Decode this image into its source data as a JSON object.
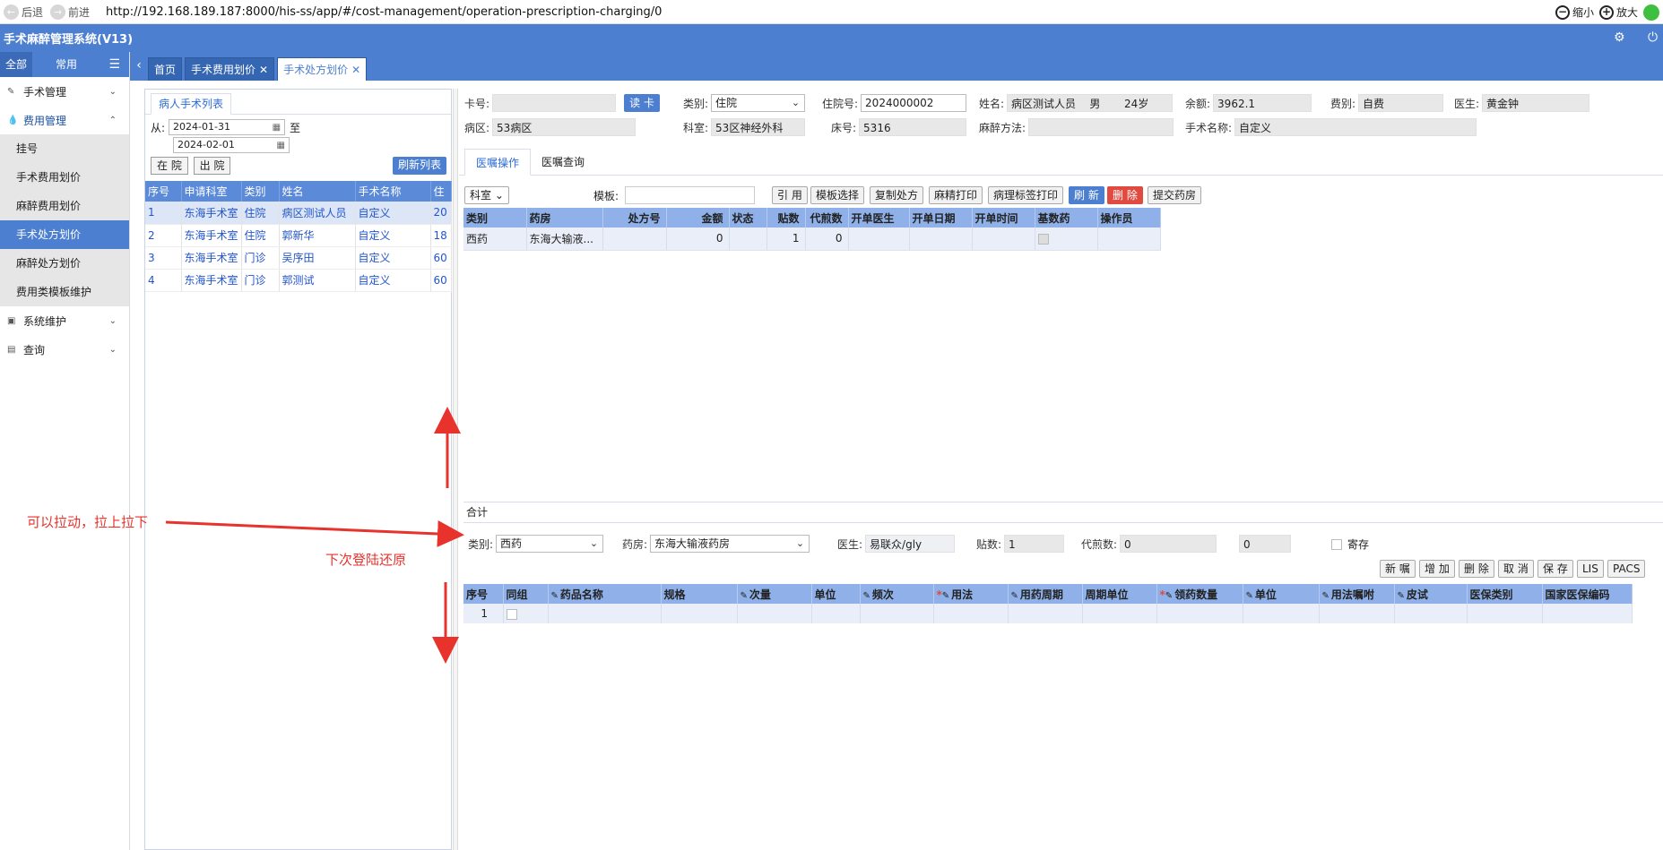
{
  "browser": {
    "back_label": "后退",
    "forward_label": "前进",
    "url": "http://192.168.189.187:8000/his-ss/app/#/cost-management/operation-prescription-charging/0",
    "zoom_out_label": "缩小",
    "zoom_in_label": "放大"
  },
  "app": {
    "title": "手术麻醉管理系统(V13)"
  },
  "sidebar": {
    "tabs": [
      "全部",
      "常用"
    ],
    "groups": [
      {
        "label": "手术管理"
      },
      {
        "label": "费用管理",
        "items": [
          "挂号",
          "手术费用划价",
          "麻醉费用划价",
          "手术处方划价",
          "麻醉处方划价",
          "费用类模板维护"
        ]
      },
      {
        "label": "系统维护"
      },
      {
        "label": "查询"
      }
    ]
  },
  "page_tabs": [
    "首页",
    "手术费用划价",
    "手术处方划价"
  ],
  "patient_panel": {
    "tab_label": "病人手术列表",
    "from_label": "从:",
    "to_label": "至",
    "date_from": "2024-01-31",
    "date_to": "2024-02-01",
    "btn_inpatient": "在 院",
    "btn_discharged": "出 院",
    "btn_refresh": "刷新列表",
    "columns": [
      "序号",
      "申请科室",
      "类别",
      "姓名",
      "手术名称",
      "住"
    ],
    "rows": [
      [
        "1",
        "东海手术室",
        "住院",
        "病区测试人员",
        "自定义",
        "20"
      ],
      [
        "2",
        "东海手术室",
        "住院",
        "郭新华",
        "自定义",
        "18"
      ],
      [
        "3",
        "东海手术室",
        "门诊",
        "吴序田",
        "自定义",
        "60"
      ],
      [
        "4",
        "东海手术室",
        "门诊",
        "郭测试",
        "自定义",
        "60"
      ]
    ]
  },
  "patient_info": {
    "card_label": "卡号:",
    "card_value": "",
    "read_card": "读 卡",
    "type_label": "类别:",
    "type_value": "住院",
    "inpatient_no_label": "住院号:",
    "inpatient_no": "2024000002",
    "name_label": "姓名:",
    "name_value": "病区测试人员",
    "gender": "男",
    "age": "24岁",
    "balance_label": "余额:",
    "balance": "3962.1",
    "fee_type_label": "费别:",
    "fee_type": "自费",
    "doctor_label": "医生:",
    "doctor": "黄金钟",
    "ward_label": "病区:",
    "ward": "53病区",
    "dept_label": "科室:",
    "dept": "53区神经外科",
    "bed_label": "床号:",
    "bed": "5316",
    "anesthesia_label": "麻醉方法:",
    "anesthesia": "",
    "surgery_label": "手术名称:",
    "surgery": "自定义"
  },
  "order_tabs": [
    "医嘱操作",
    "医嘱查询"
  ],
  "toolbar": {
    "dept_select": "科室",
    "template_label": "模板:",
    "template_value": "",
    "buttons": [
      "引 用",
      "模板选择",
      "复制处方",
      "麻精打印",
      "病理标签打印",
      "刷 新",
      "删 除",
      "提交药房"
    ]
  },
  "rx_table": {
    "columns": [
      "类别",
      "药房",
      "处方号",
      "金额",
      "状态",
      "贴数",
      "代煎数",
      "开单医生",
      "开单日期",
      "开单时间",
      "基数药",
      "操作员"
    ],
    "rows": [
      [
        "西药",
        "东海大输液...",
        "",
        "0",
        "",
        "1",
        "0",
        "",
        "",
        "",
        "",
        ""
      ]
    ],
    "sum_label": "合计"
  },
  "detail_form": {
    "type_label": "类别:",
    "type_value": "西药",
    "pharmacy_label": "药房:",
    "pharmacy_value": "东海大输液药房",
    "doctor_label": "医生:",
    "doctor_value": "易联众/gly",
    "doses_label": "贴数:",
    "doses_value": "1",
    "decoct_label": "代煎数:",
    "decoct_value": "0",
    "decoct_value2": "0",
    "deposit_label": "寄存"
  },
  "detail_buttons": [
    "新 嘱",
    "增 加",
    "删 除",
    "取 消",
    "保 存",
    "LIS",
    "PACS"
  ],
  "drug_table": {
    "columns": [
      "序号",
      "同组",
      "药品名称",
      "规格",
      "次量",
      "单位",
      "频次",
      "用法",
      "用药周期",
      "周期单位",
      "领药数量",
      "单位",
      "用法嘱咐",
      "皮试",
      "医保类别",
      "国家医保编码"
    ],
    "rows": [
      [
        "1",
        "",
        "",
        "",
        "",
        "",
        "",
        "",
        "",
        "",
        "",
        "",
        "",
        "",
        "",
        ""
      ]
    ]
  },
  "annotations": {
    "drag_note": "可以拉动，拉上拉下",
    "restore_note": "下次登陆还原"
  },
  "colors": {
    "brand": "#4d7fd1",
    "annotation": "#e8322c",
    "table_header": "#8fb0e8"
  }
}
